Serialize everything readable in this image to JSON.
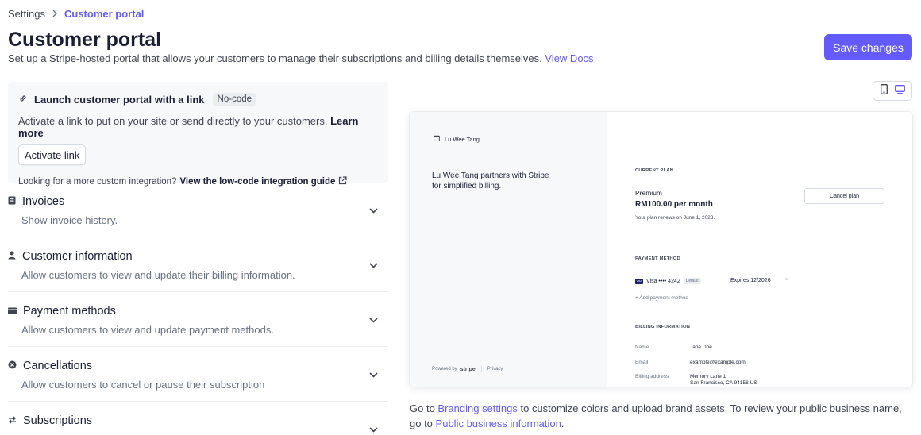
{
  "breadcrumb": {
    "parent": "Settings",
    "current": "Customer portal"
  },
  "header": {
    "title": "Customer portal",
    "description": "Set up a Stripe-hosted portal that allows your customers to manage their subscriptions and billing details themselves.",
    "docs_link": "View Docs",
    "save_label": "Save changes"
  },
  "launch": {
    "title": "Launch customer portal with a link",
    "badge": "No-code",
    "description": "Activate a link to put on your site or send directly to your customers.",
    "learn_more": "Learn more",
    "activate_label": "Activate link",
    "footer_text": "Looking for a more custom integration?",
    "footer_link": "View the low-code integration guide"
  },
  "sections": [
    {
      "title": "Invoices",
      "description": "Show invoice history.",
      "icon": "invoice-icon"
    },
    {
      "title": "Customer information",
      "description": "Allow customers to view and update their billing information.",
      "icon": "person-icon"
    },
    {
      "title": "Payment methods",
      "description": "Allow customers to view and update payment methods.",
      "icon": "card-icon"
    },
    {
      "title": "Cancellations",
      "description": "Allow customers to cancel or pause their subscription",
      "icon": "cancel-circle-icon"
    },
    {
      "title": "Subscriptions",
      "description": "",
      "icon": "swap-icon"
    }
  ],
  "preview": {
    "business_name": "Lu Wee Tang",
    "tagline": "Lu Wee Tang partners with Stripe for simplified billing.",
    "powered_by": "Powered by",
    "stripe_word": "stripe",
    "privacy": "Privacy",
    "current_plan_label": "CURRENT PLAN",
    "plan_name": "Premium",
    "plan_price": "RM100.00 per month",
    "plan_renews": "Your plan renews on June 1, 2023.",
    "cancel_plan": "Cancel plan",
    "payment_method_label": "PAYMENT METHOD",
    "card_brand": "VISA",
    "card_text": "Visa •••• 4242",
    "card_default": "Default",
    "card_expires": "Expires 12/2026",
    "card_remove": "×",
    "add_payment": "+ Add payment method",
    "billing_label": "BILLING INFORMATION",
    "billing": {
      "name_key": "Name",
      "name_val": "Jane Doe",
      "email_key": "Email",
      "email_val": "example@example.com",
      "address_key": "Billing address",
      "address_line1": "Memory Lane 1",
      "address_line2": "San Francisco, CA 94158 US"
    }
  },
  "footer": {
    "prefix": "Go to",
    "branding_link": "Branding settings",
    "middle": "to customize colors and upload brand assets. To review your public business name, go to",
    "public_link": "Public business information",
    "suffix": "."
  },
  "colors": {
    "accent": "#635bff",
    "text": "#1a1f36",
    "muted": "#687385",
    "panel": "#f6f8fa"
  }
}
